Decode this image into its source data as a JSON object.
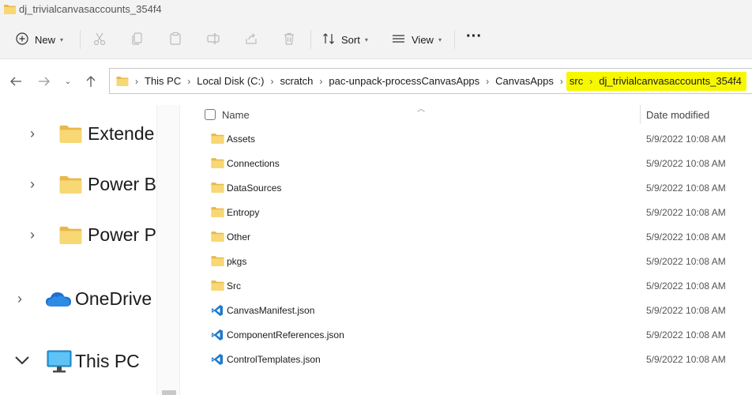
{
  "window": {
    "title": "dj_trivialcanvasaccounts_354f4"
  },
  "toolbar": {
    "new_label": "New",
    "sort_label": "Sort",
    "view_label": "View",
    "more_label": "···",
    "icons": [
      "plus-circle-icon",
      "cut-icon",
      "copy-icon",
      "paste-icon",
      "rename-icon",
      "share-icon",
      "delete-icon",
      "sort-icon",
      "view-icon",
      "more-icon"
    ]
  },
  "address": {
    "crumbs": [
      "This PC",
      "Local Disk (C:)",
      "scratch",
      "pac-unpack-processCanvasApps",
      "CanvasApps"
    ],
    "highlighted": [
      "src",
      "dj_trivialcanvasaccounts_354f4"
    ],
    "highlight_color": "#f7f700"
  },
  "nav": {
    "items": [
      {
        "label": "Extende",
        "icon": "folder-icon",
        "expanded": false
      },
      {
        "label": "Power B",
        "icon": "folder-icon",
        "expanded": false
      },
      {
        "label": "Power P",
        "icon": "folder-icon",
        "expanded": false
      },
      {
        "label": "OneDrive",
        "icon": "onedrive-icon",
        "expanded": false
      },
      {
        "label": "This PC",
        "icon": "monitor-icon",
        "expanded": true
      }
    ]
  },
  "list": {
    "headers": {
      "name": "Name",
      "date": "Date modified"
    },
    "rows": [
      {
        "name": "Assets",
        "date": "5/9/2022 10:08 AM",
        "type": "folder"
      },
      {
        "name": "Connections",
        "date": "5/9/2022 10:08 AM",
        "type": "folder"
      },
      {
        "name": "DataSources",
        "date": "5/9/2022 10:08 AM",
        "type": "folder"
      },
      {
        "name": "Entropy",
        "date": "5/9/2022 10:08 AM",
        "type": "folder"
      },
      {
        "name": "Other",
        "date": "5/9/2022 10:08 AM",
        "type": "folder"
      },
      {
        "name": "pkgs",
        "date": "5/9/2022 10:08 AM",
        "type": "folder"
      },
      {
        "name": "Src",
        "date": "5/9/2022 10:08 AM",
        "type": "folder"
      },
      {
        "name": "CanvasManifest.json",
        "date": "5/9/2022 10:08 AM",
        "type": "json"
      },
      {
        "name": "ComponentReferences.json",
        "date": "5/9/2022 10:08 AM",
        "type": "json"
      },
      {
        "name": "ControlTemplates.json",
        "date": "5/9/2022 10:08 AM",
        "type": "json"
      }
    ]
  },
  "colors": {
    "folder": "#f8d775",
    "folder_dark": "#e8b84a",
    "vscode_blue": "#1f7acc",
    "onedrive": "#1b6fd1"
  }
}
